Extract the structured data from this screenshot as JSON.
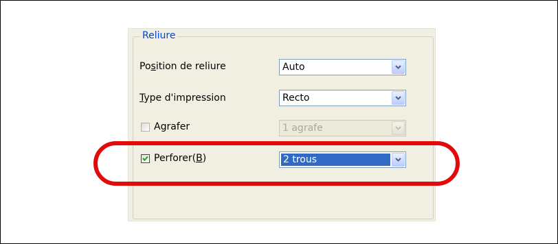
{
  "group": {
    "title": "Reliure"
  },
  "rows": {
    "position": {
      "label_pre": "Po",
      "label_ul": "s",
      "label_post": "ition de reliure",
      "value": "Auto"
    },
    "type": {
      "label_pre": "",
      "label_ul": "T",
      "label_post": "ype d'impression",
      "value": "Recto"
    },
    "staple": {
      "label": "Agrafer",
      "checked": false,
      "value": "1 agrafe",
      "disabled": true
    },
    "punch": {
      "label_pre": "Perforer(",
      "label_ul": "B",
      "label_post": ")",
      "checked": true,
      "value": "2 trous"
    }
  },
  "colors": {
    "legend": "#0046d5",
    "annotation": "#e30a0a",
    "selection": "#316ac5"
  },
  "icons": {
    "dropdown": "chevron-down-icon",
    "check": "checkmark-icon"
  }
}
